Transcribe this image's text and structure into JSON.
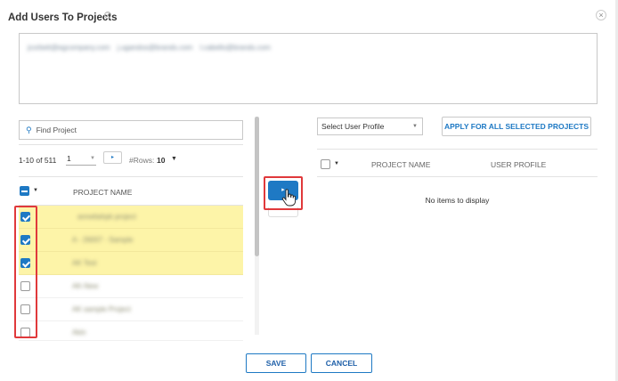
{
  "dialog": {
    "title": "Add Users To Projects",
    "help_glyph": "?",
    "close_glyph": "×"
  },
  "emails": [
    "jcorbett@egcompany.com",
    "j.ugandos@brands.com",
    "l.cabello@brands.com"
  ],
  "left": {
    "search_placeholder": "Find Project",
    "search_glyph": "🔍",
    "pager_count": "1-10 of 511",
    "page_value": "1",
    "next_glyph": "▸",
    "rows_label": "#Rows:",
    "rows_value": "10",
    "column_header": "PROJECT NAME",
    "projects": [
      {
        "name": "annettahpk project",
        "selected": true
      },
      {
        "name": "A - 26007 - Sample",
        "selected": true
      },
      {
        "name": "AK Test",
        "selected": true
      },
      {
        "name": "AK-New",
        "selected": false
      },
      {
        "name": "AK sample Project",
        "selected": false
      },
      {
        "name": "Akin",
        "selected": false
      }
    ]
  },
  "transfer": {
    "forward_glyph": "▸"
  },
  "right": {
    "profile_select_value": "Select User Profile",
    "apply_label": "APPLY FOR ALL SELECTED PROJECTS",
    "col_project": "PROJECT NAME",
    "col_profile": "USER PROFILE",
    "empty_message": "No items to display"
  },
  "footer": {
    "save_label": "SAVE",
    "cancel_label": "CANCEL"
  },
  "colors": {
    "accent": "#1e79c4",
    "selection": "#fdf4a8",
    "highlight_red": "#e0393b"
  }
}
